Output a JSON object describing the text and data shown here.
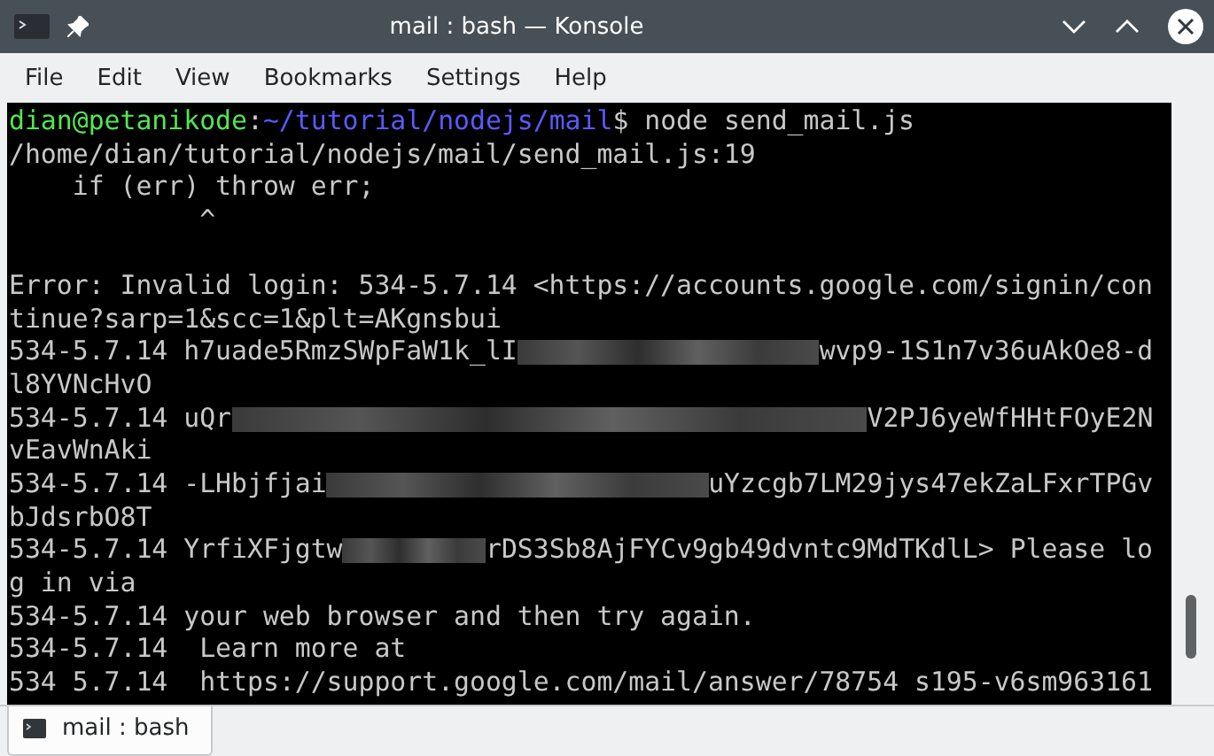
{
  "window": {
    "title": "mail : bash — Konsole"
  },
  "menu": [
    "File",
    "Edit",
    "View",
    "Bookmarks",
    "Settings",
    "Help"
  ],
  "terminal": {
    "lines": [
      [
        {
          "text": "dian@petanikode",
          "color": "#54e554"
        },
        {
          "text": ":",
          "color": "#c8c8c8"
        },
        {
          "text": "~/tutorial/nodejs/mail",
          "color": "#5a5aff"
        },
        {
          "text": "$ node send_mail.js",
          "color": "#c8c8c8"
        }
      ],
      [
        {
          "text": "/home/dian/tutorial/nodejs/mail/send_mail.js:19",
          "color": "#c8c8c8"
        }
      ],
      [
        {
          "text": "    if (err) throw err;",
          "color": "#c8c8c8"
        }
      ],
      [
        {
          "text": "            ^",
          "color": "#c8c8c8"
        }
      ],
      [
        {
          "kind": "blank"
        }
      ],
      [
        {
          "text": "Error: Invalid login: 534-5.7.14 <https://accounts.google.com/signin/con",
          "color": "#c8c8c8"
        }
      ],
      [
        {
          "text": "tinue?sarp=1&scc=1&plt=AKgnsbui",
          "color": "#c8c8c8"
        }
      ],
      [
        {
          "text": "534-5.7.14 h7uade5RmzSWpFaW1k_lI",
          "color": "#c8c8c8"
        },
        {
          "kind": "redacted"
        },
        {
          "text": "wvp9-1S1n7v36uAkOe8-d",
          "color": "#c8c8c8"
        }
      ],
      [
        {
          "text": "l8YVNcHvO",
          "color": "#c8c8c8"
        }
      ],
      [
        {
          "text": "534-5.7.14 uQr",
          "color": "#c8c8c8"
        },
        {
          "kind": "redacted"
        },
        {
          "text": "V2PJ6yeWfHHtFOyE2N",
          "color": "#c8c8c8"
        }
      ],
      [
        {
          "text": "vEavWnAki",
          "color": "#c8c8c8"
        }
      ],
      [
        {
          "text": "534-5.7.14 -LHbjfjai",
          "color": "#c8c8c8"
        },
        {
          "kind": "redacted"
        },
        {
          "text": "uYzcgb7LM29jys47ekZaLFxrTPGv",
          "color": "#c8c8c8"
        }
      ],
      [
        {
          "text": "bJdsrbO8T",
          "color": "#c8c8c8"
        }
      ],
      [
        {
          "text": "534-5.7.14 YrfiXFjgtw",
          "color": "#c8c8c8"
        },
        {
          "kind": "redacted"
        },
        {
          "text": "rDS3Sb8AjFYCv9gb49dvntc9MdTKdlL> Please lo",
          "color": "#c8c8c8"
        }
      ],
      [
        {
          "text": "g in via",
          "color": "#c8c8c8"
        }
      ],
      [
        {
          "text": "534-5.7.14 your web browser and then try again.",
          "color": "#c8c8c8"
        }
      ],
      [
        {
          "text": "534-5.7.14  Learn more at",
          "color": "#c8c8c8"
        }
      ],
      [
        {
          "text": "534 5.7.14  https://support.google.com/mail/answer/78754 s195-v6sm963161",
          "color": "#c8c8c8"
        }
      ]
    ]
  },
  "tabs": [
    {
      "label": "mail : bash",
      "selected": true
    }
  ]
}
